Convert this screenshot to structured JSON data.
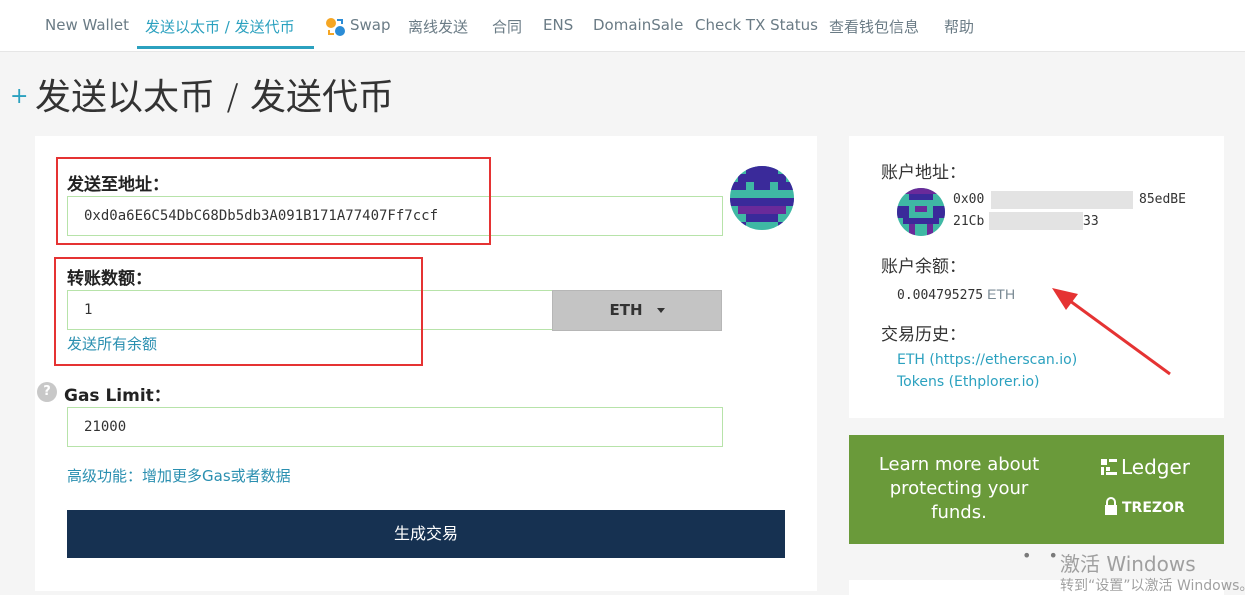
{
  "nav": {
    "items": [
      "New Wallet",
      "发送以太币 / 发送代币",
      "Swap",
      "离线发送",
      "合同",
      "ENS",
      "DomainSale",
      "Check TX Status",
      "查看钱包信息",
      "帮助"
    ],
    "active_index": 1
  },
  "title": {
    "plus": "+",
    "text": "发送以太币 / 发送代币"
  },
  "send_form": {
    "to_label": "发送至地址：",
    "to_value": "0xd0a6E6C54DbC68Db5db3A091B171A77407Ff7ccf",
    "amount_label": "转账数额：",
    "amount_value": "1",
    "currency": "ETH",
    "send_all_label": "发送所有余额",
    "help_glyph": "?",
    "gas_label": "Gas Limit：",
    "gas_value": "21000",
    "advanced_label": "高级功能：增加更多Gas或者数据",
    "generate_label": "生成交易"
  },
  "account": {
    "address_label": "账户地址：",
    "address_line1_start": "0x00",
    "address_line1_end": "85edBE",
    "address_line2_start": "21Cb",
    "address_line2_end": "33",
    "balance_label": "账户余额：",
    "balance_value": "0.004795275",
    "balance_unit": "ETH",
    "history_label": "交易历史：",
    "history_links": [
      "ETH (https://etherscan.io)",
      "Tokens (Ethplorer.io)"
    ]
  },
  "promo": {
    "text": "Learn more about protecting your funds.",
    "ledger": "Ledger",
    "trezor": "TREZOR"
  },
  "watermark": {
    "line1": "激活 Windows",
    "line2": "转到“设置”以激活 Windows。"
  },
  "colors": {
    "accent": "#2ba1bf",
    "primary_button": "#163151",
    "annotation": "#e53333",
    "promo_bg": "#6a9a3a"
  },
  "icons": {
    "swap": "swap-icon",
    "help": "help-icon",
    "identicon": "identicon",
    "ledger": "ledger-logo-icon",
    "trezor": "trezor-lock-icon",
    "arrow": "red-arrow"
  }
}
